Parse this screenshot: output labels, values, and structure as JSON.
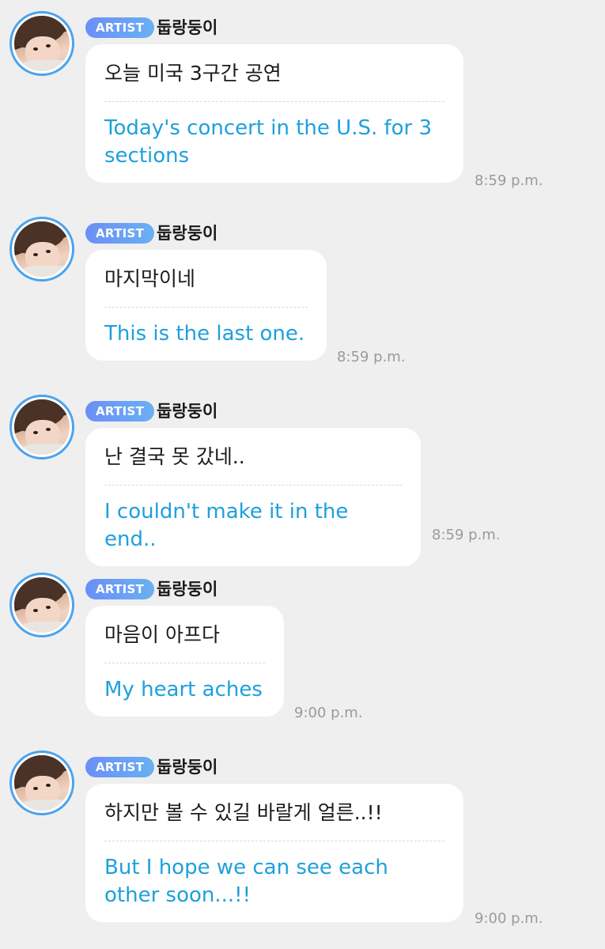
{
  "messages": [
    {
      "badge": "ARTIST",
      "name": "둡랑둥이",
      "original": "오늘 미국 3구간 공연",
      "translation": "Today's concert in the U.S. for 3 sections",
      "time": "8:59 p.m."
    },
    {
      "badge": "ARTIST",
      "name": "둡랑둥이",
      "original": "마지막이네",
      "translation": "This is the last one.",
      "time": "8:59 p.m."
    },
    {
      "badge": "ARTIST",
      "name": "둡랑둥이",
      "original": "난 결국 못 갔네..",
      "translation": "I couldn't make it in the end..",
      "time": "8:59 p.m."
    },
    {
      "badge": "ARTIST",
      "name": "둡랑둥이",
      "original": "마음이 아프다",
      "translation": "My heart aches",
      "time": "9:00 p.m."
    },
    {
      "badge": "ARTIST",
      "name": "둡랑둥이",
      "original": "하지만 볼 수 있길 바랄게 얼른..!!",
      "translation": "But I hope we can see each other soon...!!",
      "time": "9:00 p.m."
    }
  ]
}
